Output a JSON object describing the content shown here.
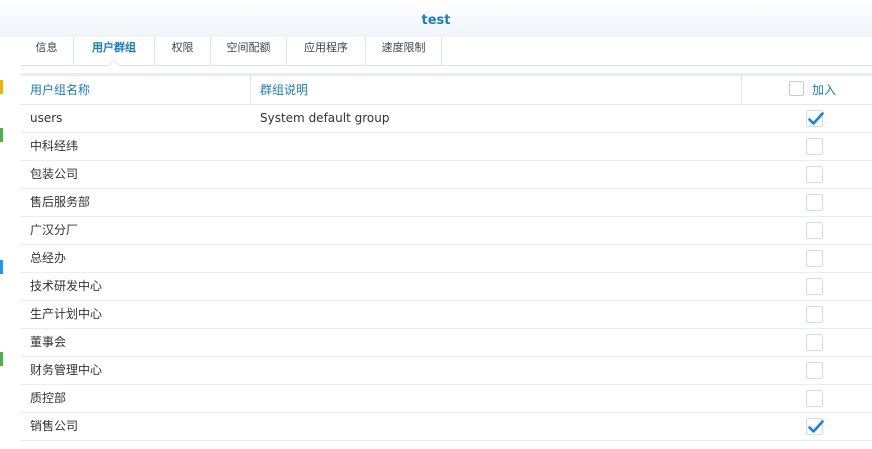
{
  "window": {
    "title": "test"
  },
  "tabs": [
    {
      "label": "信息",
      "active": false
    },
    {
      "label": "用户群组",
      "active": true
    },
    {
      "label": "权限",
      "active": false
    },
    {
      "label": "空间配额",
      "active": false
    },
    {
      "label": "应用程序",
      "active": false
    },
    {
      "label": "速度限制",
      "active": false
    }
  ],
  "table": {
    "columns": {
      "name": "用户组名称",
      "description": "群组说明",
      "join": "加入"
    },
    "rows": [
      {
        "name": "users",
        "description": "System default group",
        "joined": true
      },
      {
        "name": "中科经纬",
        "description": "",
        "joined": false
      },
      {
        "name": "包装公司",
        "description": "",
        "joined": false
      },
      {
        "name": "售后服务部",
        "description": "",
        "joined": false
      },
      {
        "name": "广汉分厂",
        "description": "",
        "joined": false
      },
      {
        "name": "总经办",
        "description": "",
        "joined": false
      },
      {
        "name": "技术研发中心",
        "description": "",
        "joined": false
      },
      {
        "name": "生产计划中心",
        "description": "",
        "joined": false
      },
      {
        "name": "董事会",
        "description": "",
        "joined": false
      },
      {
        "name": "财务管理中心",
        "description": "",
        "joined": false
      },
      {
        "name": "质控部",
        "description": "",
        "joined": false
      },
      {
        "name": "销售公司",
        "description": "",
        "joined": true
      }
    ]
  },
  "colors": {
    "accent": "#1f7cb5",
    "check": "#1a86c8",
    "edge_marks": [
      "#e8b400",
      "#4caf50",
      "#2196f3",
      "#4caf50"
    ]
  },
  "icons": {
    "checkbox_checked": "checkmark-icon"
  }
}
